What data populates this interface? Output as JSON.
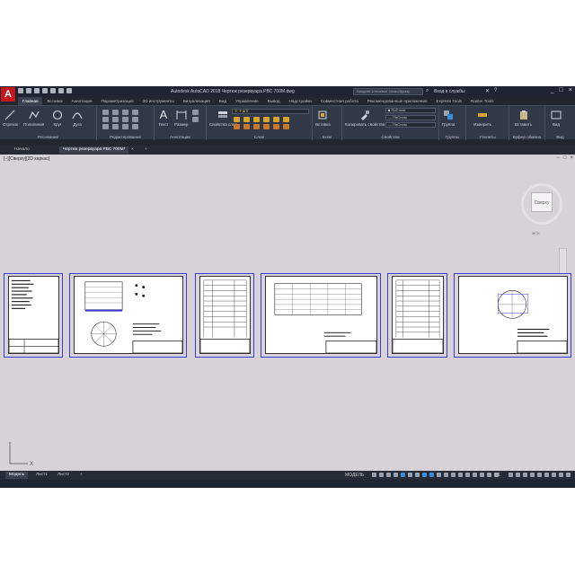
{
  "app": {
    "logo": "A",
    "title": "Autodesk AutoCAD 2018    Чертеж резервуара РВС 700М.dwg",
    "search_placeholder": "Введите ключевое слово/фразу",
    "signin": "Вход в службы",
    "window_controls": [
      "_",
      "□",
      "×"
    ]
  },
  "ribbon_tabs": [
    {
      "label": "Главная",
      "active": true
    },
    {
      "label": "Вставка"
    },
    {
      "label": "Аннотации"
    },
    {
      "label": "Параметризация"
    },
    {
      "label": "3D инструменты"
    },
    {
      "label": "Визуализация"
    },
    {
      "label": "Вид"
    },
    {
      "label": "Управление"
    },
    {
      "label": "Вывод"
    },
    {
      "label": "Надстройки"
    },
    {
      "label": "Совместная работа"
    },
    {
      "label": "Рекомендованные приложения"
    },
    {
      "label": "Express Tools"
    },
    {
      "label": "Raster Tools"
    }
  ],
  "ribbon": {
    "draw_tools": [
      "Отрезок",
      "Полилиния",
      "Круг",
      "Дуга"
    ],
    "panels": {
      "draw": "Рисование",
      "modify": "Редактирование",
      "annotation": "Аннотации",
      "layers": "Слои",
      "block": "Блок",
      "properties": "Свойства",
      "groups": "Группы",
      "utilities": "Утилиты",
      "clipboard": "Буфер обмена",
      "view": "Вид"
    },
    "annotation_tools": [
      "Текст",
      "Размер"
    ],
    "layer_tool": "Свойства слоя",
    "block_tool": "Вставка",
    "match_tool": "Копировать свойства",
    "property_values": [
      "ПоСлою",
      "ПоСлою",
      "ПоСлою"
    ],
    "group_tool": "Группа",
    "measure_tool": "Измерить",
    "paste_tool": "Вставить",
    "view_tool": "Вид"
  },
  "doc_tabs": {
    "start": "Начало",
    "file": "Чертеж резервуара РВС 700М*",
    "close": "×",
    "add": "+"
  },
  "canvas": {
    "view_label": "[−][Сверху][2D каркас]",
    "viewcube_face": "Сверху",
    "wcs": "МСК",
    "ucs_y": "Y",
    "ucs_x": "X",
    "inner_controls": [
      "−",
      "□",
      "×"
    ]
  },
  "layout_tabs": {
    "model": "Модель",
    "sheet1": "Лист1",
    "sheet2": "Лист2",
    "add": "+"
  },
  "status": {
    "mode": "МОДЕЛЬ",
    "scale": "1:1"
  },
  "colors": {
    "accent": "#c4161c",
    "canvas": "#d7d2d7",
    "ribbon": "#323946",
    "frame": "#3b3bd6"
  }
}
